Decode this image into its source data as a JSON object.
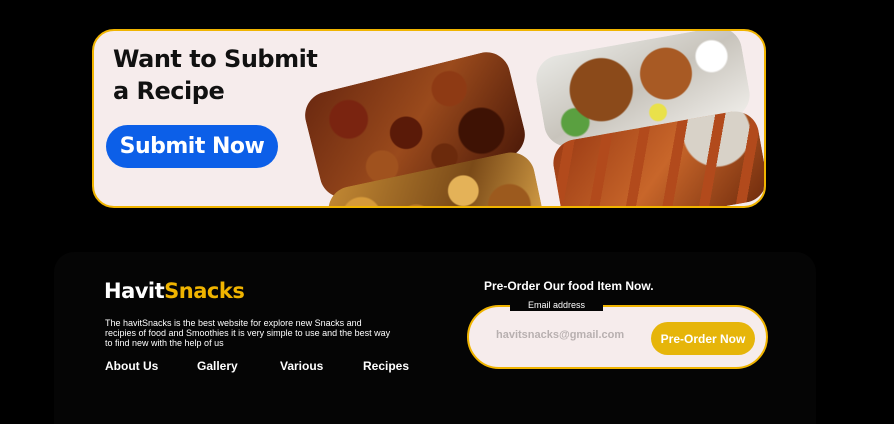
{
  "banner": {
    "title": "Want to Submit a Recipe",
    "submit_button": "Submit Now",
    "photos": [
      {
        "icon": "fried-meat-photo"
      },
      {
        "icon": "grilled-skewers-photo"
      },
      {
        "icon": "grilled-fish-photo"
      },
      {
        "icon": "kebab-skewers-photo"
      }
    ]
  },
  "footer": {
    "logo": {
      "part1": "Havit",
      "part2": "Snacks"
    },
    "description": "The havitSnacks is the best website for explore new Snacks and recipies of food and Smoothies it is very simple to use and the best way to find new with the help of us",
    "nav": [
      "About Us",
      "Gallery",
      "Various",
      "Recipes"
    ],
    "preorder": {
      "heading": "Pre-Order Our food Item Now.",
      "email_label": "Email address",
      "email_placeholder": "havitsnacks@gmail.com",
      "button": "Pre-Order Now"
    }
  },
  "colors": {
    "accent_yellow": "#f0b400",
    "button_blue": "#0c5fe8",
    "background": "#000000",
    "card_background": "#f6ecec"
  }
}
